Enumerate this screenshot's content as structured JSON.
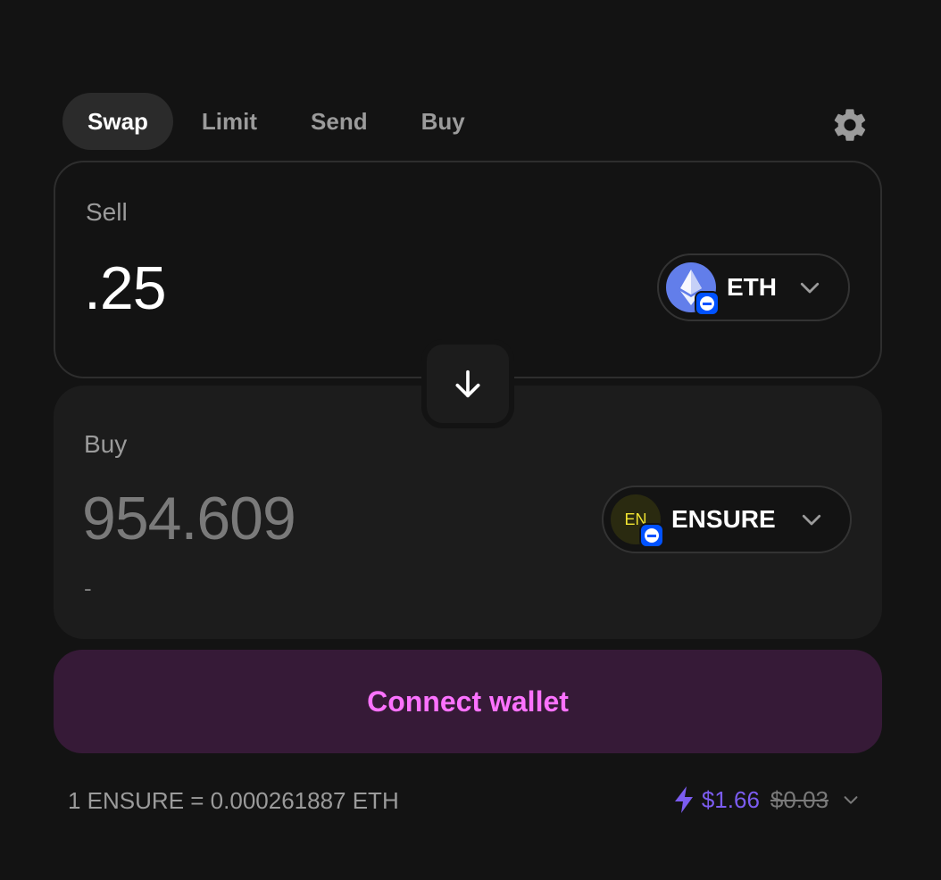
{
  "tabs": [
    {
      "label": "Swap",
      "active": true
    },
    {
      "label": "Limit",
      "active": false
    },
    {
      "label": "Send",
      "active": false
    },
    {
      "label": "Buy",
      "active": false
    }
  ],
  "settings_icon": "gear-icon",
  "sell": {
    "label": "Sell",
    "amount": ".25",
    "token": {
      "symbol": "ETH",
      "logo_color": "#627eea"
    }
  },
  "buy": {
    "label": "Buy",
    "amount": "954.609",
    "usd_value": "-",
    "token": {
      "symbol": "ENSURE",
      "logo_text": "EN",
      "logo_color": "#f1e432"
    }
  },
  "swap_direction_icon": "arrow-down-icon",
  "connect_label": "Connect wallet",
  "rate": "1 ENSURE = 0.000261887 ETH",
  "fees": {
    "current": "$1.66",
    "previous": "$0.03"
  },
  "colors": {
    "background": "#131313",
    "accent": "#fc72ff",
    "accent_bg": "#361a37",
    "fee_purple": "#7b5cf0",
    "chain_badge": "#0052ff"
  }
}
